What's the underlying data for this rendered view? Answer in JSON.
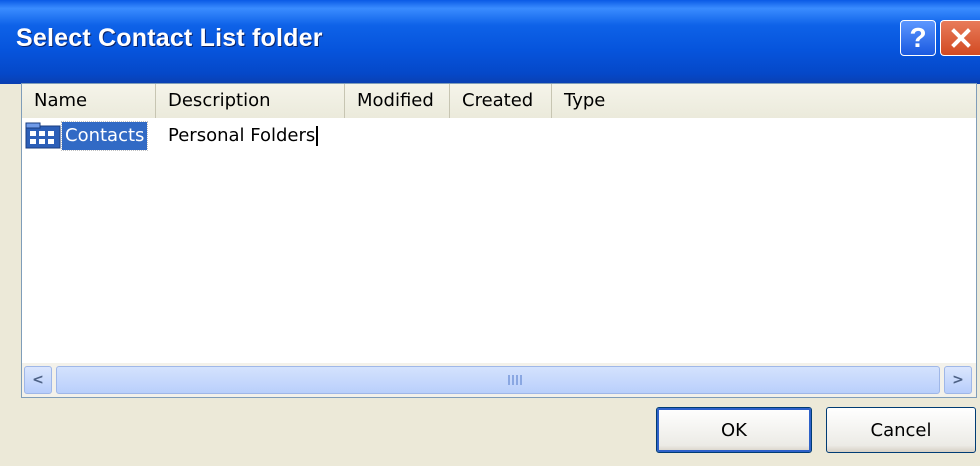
{
  "window": {
    "title": "Select Contact List folder",
    "help_label": "?",
    "close_label": "✕"
  },
  "list": {
    "columns": [
      "Name",
      "Description",
      "Modified",
      "Created",
      "Type"
    ],
    "rows": [
      {
        "name": "Contacts",
        "description": "Personal Folders",
        "icon": "contacts-folder-icon",
        "selected": true
      }
    ]
  },
  "scrollbar": {
    "left_arrow": "<",
    "right_arrow": ">",
    "orientation": "horizontal"
  },
  "buttons": {
    "ok_label": "OK",
    "cancel_label": "Cancel"
  },
  "colors": {
    "titlebar": "#0654dc",
    "selection": "#316ac5",
    "dialog_bg": "#ece9d8"
  }
}
